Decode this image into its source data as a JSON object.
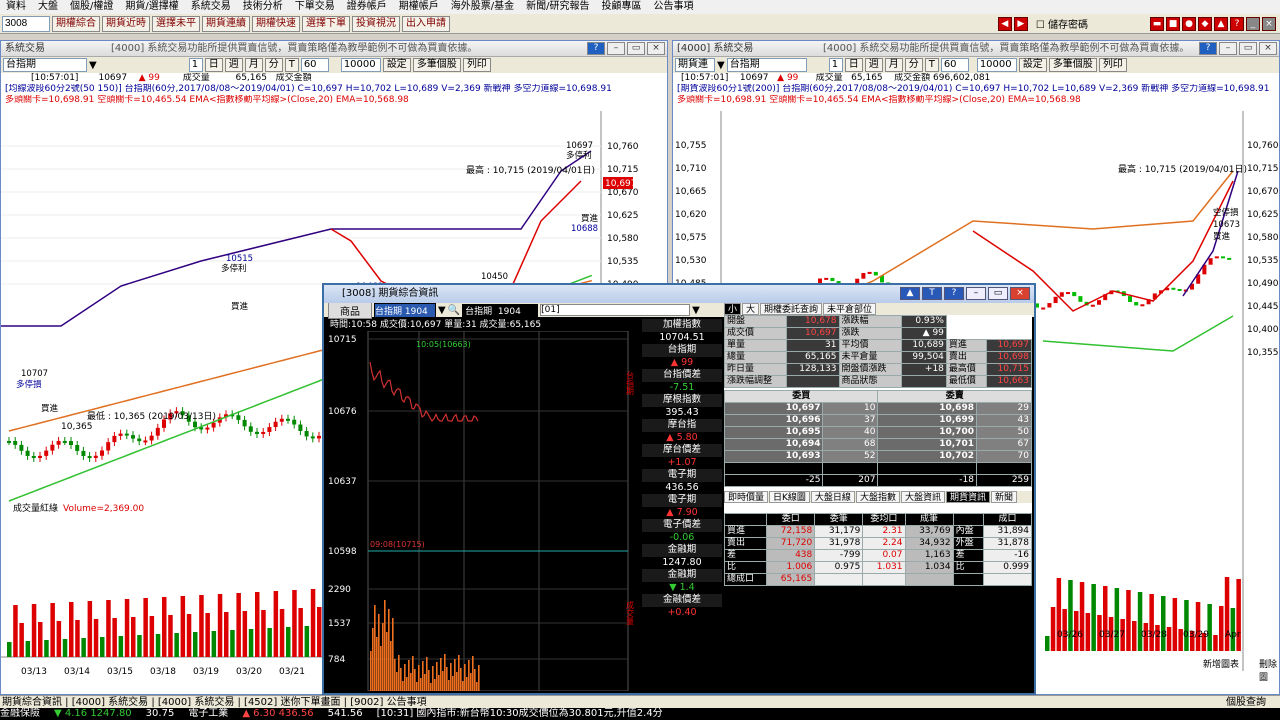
{
  "menu": [
    "資料",
    "大盤",
    "個股/權證",
    "期貨/選擇權",
    "系統交易",
    "技術分析",
    "下單交易",
    "證券帳戶",
    "期權帳戶",
    "海外股票/基金",
    "新聞/研究報告",
    "投顧專區",
    "公告事項"
  ],
  "toolbar": {
    "code": "3008",
    "buttons": [
      "期權綜合",
      "期貨近時",
      "選擇未平",
      "期貨連續",
      "期權快速",
      "選擇下單",
      "投資視況",
      "出入申請"
    ],
    "checkbox_label": "儲存密碼"
  },
  "left_win": {
    "title": "系統交易",
    "note": "[4000] 系統交易功能所提供買賣信號，買賣策略僅為教學範例不可做為買賣依據。",
    "product": "台指期",
    "period": "60",
    "count": "10000",
    "btns": [
      "設定",
      "多筆個股",
      "列印"
    ],
    "row1": [
      "[10:57:01]",
      "10697",
      "99",
      "成交量",
      "65,165",
      "成交金額"
    ],
    "line1": "[均線波段60分2號(50 150)] 台指期(60分,2017/08/08～2019/04/01) C=10,697 H=10,702 L=10,689 V=2,369 新戰神 多空力道線=10,698.91",
    "line2": "多頭關卡=10,698.91 空頭關卡=10,465.54 EMA<指數移動平均線>(Close,20) EMA=10,568.98",
    "yticks": [
      "10,760",
      "10,715",
      "10,670",
      "10,625",
      "10,580",
      "10,535",
      "10,490"
    ],
    "hl": "最高 : 10,715 (2019/04/01日)",
    "low": "10,365",
    "low_label": "最低 : 10,365 (2019/03/13日)",
    "vol_label": "成交量紅綠",
    "vol_val": "Volume=2,369.00",
    "dates": [
      "03/13",
      "03/14",
      "03/15",
      "03/18",
      "03/19",
      "03/20",
      "03/21"
    ],
    "labels": [
      "10515",
      "多停利",
      "買進",
      "10461",
      "多停損",
      "10450",
      "買進",
      "10697",
      "多停利",
      "10688",
      "買進",
      "10707",
      "多停損",
      "買進",
      "空停損",
      "10465"
    ]
  },
  "right_win": {
    "title": "[4000] 系統交易",
    "note": "[4000] 系統交易功能所提供買賣信號，買賣策略僅為教學範例不可做為買賣依據。",
    "product": "期貨連",
    "sub": "台指期",
    "count": "10000",
    "btns": [
      "設定",
      "多筆個股",
      "列印"
    ],
    "row1": [
      "[10:57:01]",
      "10697",
      "99",
      "成交量",
      "65,165",
      "成交金額",
      "696,602,081"
    ],
    "line1": "[期貨波段60分1號(200)] 台指期(60分,2017/08/08～2019/04/01) C=10,697 H=10,702 L=10,689 V=2,369 新戰神 多空力道線=10,698.91",
    "line2": "多頭關卡=10,698.91 空頭關卡=10,465.54 EMA<指數移動平均線>(Close,20) EMA=10,568.98",
    "yticks_left": [
      "10,755",
      "10,710",
      "10,665",
      "10,620",
      "10,575",
      "10,530",
      "10,485"
    ],
    "yticks_right": [
      "10,760",
      "10,715",
      "10,670",
      "10,625",
      "10,580",
      "10,535",
      "10,490",
      "10,445",
      "10,400",
      "10,355"
    ],
    "hl": "最高 : 10,715 (2019/04/01日)",
    "dates": [
      "03/26",
      "03/27",
      "03/28",
      "03/29",
      "Apr"
    ],
    "labels": [
      "空停損",
      "10673",
      "買進"
    ],
    "btn_new": "新增圖表",
    "btn_del": "刪除圖"
  },
  "quote": {
    "title": "[3008] 期貨綜合資訊",
    "product_label": "商品",
    "product": "台指期 1904",
    "code_label": "台指期",
    "code": "1904",
    "field": "[01]",
    "time_line": "時間:10:58 成交價:10,697 單量:31 成交量:65,165",
    "yticks": [
      "10715",
      "10676",
      "10637",
      "10598",
      "2290",
      "1537",
      "784"
    ],
    "chart_ann1": "10:05(10663)",
    "chart_ann2": "09:08(10715)",
    "side_label1": "台指期",
    "side_label2": "成交量",
    "list": [
      {
        "h": "加權指數",
        "v": "10704.51"
      },
      {
        "h": "台指期",
        "v": "▲ 99"
      },
      {
        "h": "台指價差",
        "v": "-7.51"
      },
      {
        "h": "摩根指數",
        "v": "395.43"
      },
      {
        "h": "摩台指",
        "v": "▲ 5.80"
      },
      {
        "h": "摩台價差",
        "v": "+1.07"
      },
      {
        "h": "電子期",
        "v": "436.56"
      },
      {
        "h": "電子期",
        "v": "▲ 7.90"
      },
      {
        "h": "電子價差",
        "v": "-0.06"
      },
      {
        "h": "金融期",
        "v": "1247.80"
      },
      {
        "h": "金融期",
        "v": "▼ 1.4"
      },
      {
        "h": "金融價差",
        "v": "+0.40"
      }
    ],
    "rtabs": [
      "小",
      "大",
      "期權委託查詢",
      "未平倉部位"
    ],
    "stats": [
      [
        "開盤",
        "10,678",
        "漲跌幅",
        "0.93%"
      ],
      [
        "成交價",
        "10,697",
        "漲跌",
        "▲ 99"
      ],
      [
        "單量",
        "31",
        "平均價",
        "10,689",
        "買進",
        "10,697"
      ],
      [
        "總量",
        "65,165",
        "未平倉量",
        "99,504",
        "賣出",
        "10,698"
      ],
      [
        "昨日量",
        "128,133",
        "開盤價漲跌",
        "+18",
        "最高價",
        "10,715"
      ],
      [
        "漲跌幅調整",
        "",
        "商品狀態",
        "",
        "最低價",
        "10,663"
      ]
    ],
    "depth_head": [
      "委買",
      "委賣"
    ],
    "depth": [
      [
        "10,697",
        "10",
        "10,698",
        "29"
      ],
      [
        "10,696",
        "37",
        "10,699",
        "43"
      ],
      [
        "10,695",
        "40",
        "10,700",
        "50"
      ],
      [
        "10,694",
        "68",
        "10,701",
        "67"
      ],
      [
        "10,693",
        "52",
        "10,702",
        "70"
      ]
    ],
    "depth_sum": [
      "-25",
      "207",
      "-18",
      "259"
    ],
    "tabs2": [
      "即時價量",
      "日K線圖",
      "大盤日線",
      "大盤指數",
      "大盤資訊",
      "期貨資訊",
      "新聞"
    ],
    "t2head": [
      "",
      "委口",
      "委筆",
      "委均口",
      "成筆",
      "",
      "成口"
    ],
    "t2rows": [
      [
        "買進",
        "72,158",
        "31,179",
        "2.31",
        "33,769",
        "內盤",
        "31,894"
      ],
      [
        "賣出",
        "71,720",
        "31,978",
        "2.24",
        "34,932",
        "外盤",
        "31,878"
      ],
      [
        "差",
        "438",
        "-799",
        "0.07",
        "1,163",
        "差",
        "-16"
      ],
      [
        "比",
        "1.006",
        "0.975",
        "1.031",
        "1.034",
        "比",
        "0.999"
      ],
      [
        "總成口",
        "65,165",
        "",
        "",
        "",
        "",
        ""
      ]
    ]
  },
  "tabbar": "期貨綜合資訊 | [4000] 系統交易 | [4000] 系統交易 | [4502] 迷你下單畫面 | [9002] 公告事項",
  "tabbar_right": "個股查詢",
  "status": {
    "items": [
      "金融保險",
      "▼ 4.16 1247.80",
      "30.75",
      "電子工業",
      "▲ 6.30 436.56",
      "541.56",
      "[10:31] 國內指市:新台幣10:30成交價位為30.801元,升值2.4分"
    ]
  }
}
